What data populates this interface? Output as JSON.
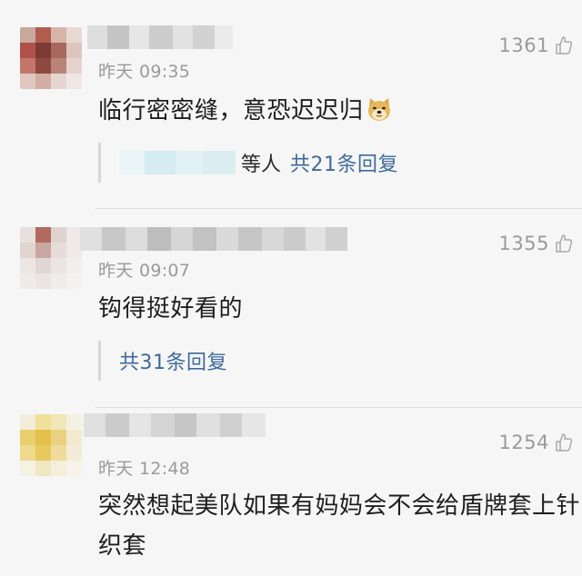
{
  "comments": [
    {
      "time": "昨天 09:35",
      "likes": "1361",
      "content": "临行密密缝，意恐迟迟归",
      "emoji": "doge-emoji",
      "reply_prefix": "等人",
      "reply_link": "共21条回复"
    },
    {
      "time": "昨天 09:07",
      "likes": "1355",
      "content": "钩得挺好看的",
      "reply_link": "共31条回复"
    },
    {
      "time": "昨天 12:48",
      "likes": "1254",
      "content": "突然想起美队如果有妈妈会不会给盾牌套上针织套"
    }
  ],
  "icons": {
    "like": "thumbs-up-outline-icon"
  },
  "colors": {
    "background": "#f6f6f6",
    "text": "#1e1e1e",
    "meta": "#9a9a9a",
    "link": "#3f6a9e",
    "divider": "#dcdcdc"
  }
}
